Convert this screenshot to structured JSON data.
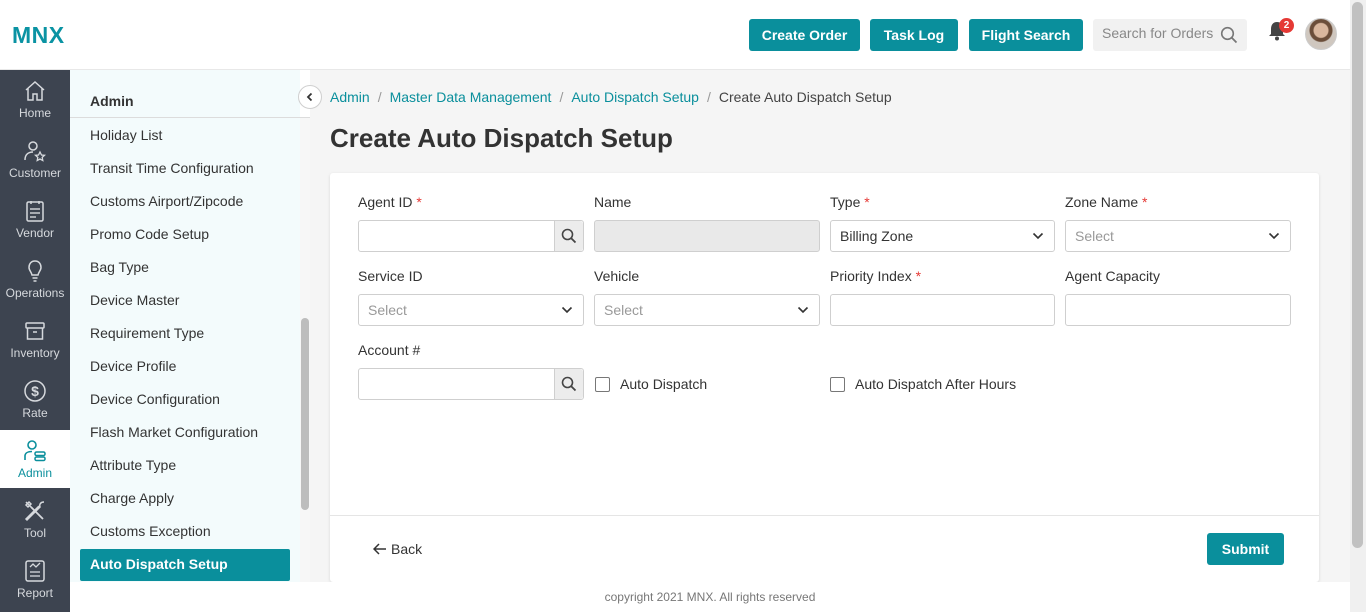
{
  "brand": {
    "logo_text": "MNX",
    "accent": "#0a8f9c"
  },
  "header": {
    "buttons": [
      "Create Order",
      "Task Log",
      "Flight Search"
    ],
    "search_placeholder": "Search for Orders",
    "notification_count": "2"
  },
  "nav": {
    "items": [
      {
        "label": "Home",
        "icon": "home-icon"
      },
      {
        "label": "Customer",
        "icon": "customer-icon"
      },
      {
        "label": "Vendor",
        "icon": "vendor-icon"
      },
      {
        "label": "Operations",
        "icon": "bulb-icon"
      },
      {
        "label": "Inventory",
        "icon": "box-icon"
      },
      {
        "label": "Rate",
        "icon": "dollar-icon"
      },
      {
        "label": "Admin",
        "icon": "admin-icon",
        "active": true
      },
      {
        "label": "Tool",
        "icon": "tools-icon"
      },
      {
        "label": "Report",
        "icon": "report-icon"
      }
    ]
  },
  "submenu": {
    "title": "Admin",
    "items": [
      "Holiday List",
      "Transit Time Configuration",
      "Customs Airport/Zipcode",
      "Promo Code Setup",
      "Bag Type",
      "Device Master",
      "Requirement Type",
      "Device Profile",
      "Device Configuration",
      "Flash Market Configuration",
      "Attribute Type",
      "Charge Apply",
      "Customs Exception",
      "Auto Dispatch Setup"
    ],
    "active_item": "Auto Dispatch Setup"
  },
  "breadcrumb": {
    "links": [
      "Admin",
      "Master Data Management",
      "Auto Dispatch Setup"
    ],
    "current": "Create Auto Dispatch Setup",
    "separator": "/"
  },
  "page": {
    "title": "Create Auto Dispatch Setup"
  },
  "form": {
    "agent_id": {
      "label": "Agent ID",
      "required": "*",
      "value": ""
    },
    "name": {
      "label": "Name",
      "value": ""
    },
    "type": {
      "label": "Type",
      "required": "*",
      "value": "Billing Zone"
    },
    "zone_name": {
      "label": "Zone Name",
      "required": "*",
      "placeholder": "Select"
    },
    "service_id": {
      "label": "Service ID",
      "placeholder": "Select"
    },
    "vehicle": {
      "label": "Vehicle",
      "placeholder": "Select"
    },
    "priority_index": {
      "label": "Priority Index",
      "required": "*",
      "value": ""
    },
    "agent_capacity": {
      "label": "Agent Capacity",
      "value": ""
    },
    "account": {
      "label": "Account #",
      "value": ""
    },
    "auto_dispatch": {
      "label": "Auto Dispatch",
      "checked": false
    },
    "auto_dispatch_after_hours": {
      "label": "Auto Dispatch After Hours",
      "checked": false
    }
  },
  "actions": {
    "back": "Back",
    "submit": "Submit"
  },
  "footer": {
    "text": "copyright 2021 MNX. All rights reserved"
  }
}
